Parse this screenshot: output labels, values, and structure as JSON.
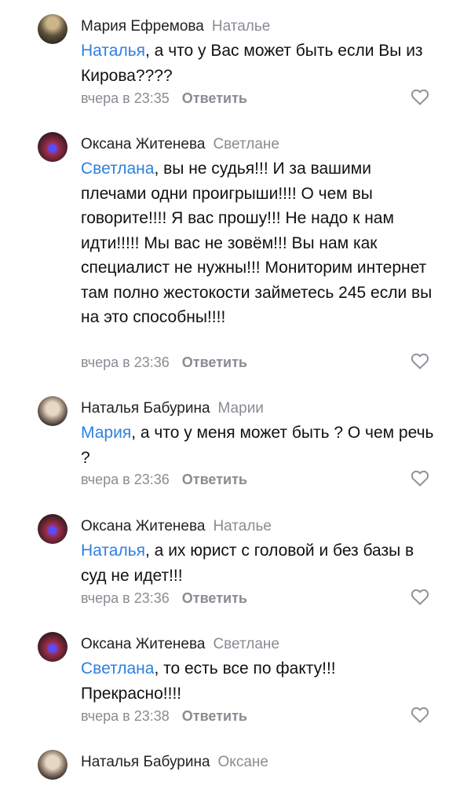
{
  "comments": [
    {
      "author": "Мария Ефремова",
      "reply_to": "Наталье",
      "mention": "Наталья",
      "text": ", а что у Вас может быть если Вы из Кирова????",
      "time": "вчера в 23:35",
      "reply_label": "Ответить"
    },
    {
      "author": "Оксана Житенева",
      "reply_to": "Светлане",
      "mention": "Светлана",
      "text": ", вы не судья!!! И за вашими плечами одни проигрыши!!!! О чем вы говорите!!!! Я вас прошу!!! Не надо к нам идти!!!!! Мы вас не зовём!!! Вы нам как специалист не нужны!!! Мониторим интернет там полно жестокости займетесь 245 если вы на это способны!!!!",
      "time": "вчера в 23:36",
      "reply_label": "Ответить"
    },
    {
      "author": "Наталья Бабурина",
      "reply_to": "Марии",
      "mention": "Мария",
      "text": ", а что у меня может быть ? О чем речь ?",
      "time": "вчера в 23:36",
      "reply_label": "Ответить"
    },
    {
      "author": "Оксана Житенева",
      "reply_to": "Наталье",
      "mention": "Наталья",
      "text": ", а их юрист с головой и без базы в суд не идет!!!",
      "time": "вчера в 23:36",
      "reply_label": "Ответить"
    },
    {
      "author": "Оксана Житенева",
      "reply_to": "Светлане",
      "mention": "Светлана",
      "text": ", то есть все по факту!!! Прекрасно!!!!",
      "time": "вчера в 23:38",
      "reply_label": "Ответить"
    },
    {
      "author": "Наталья Бабурина",
      "reply_to": "Оксане"
    }
  ]
}
